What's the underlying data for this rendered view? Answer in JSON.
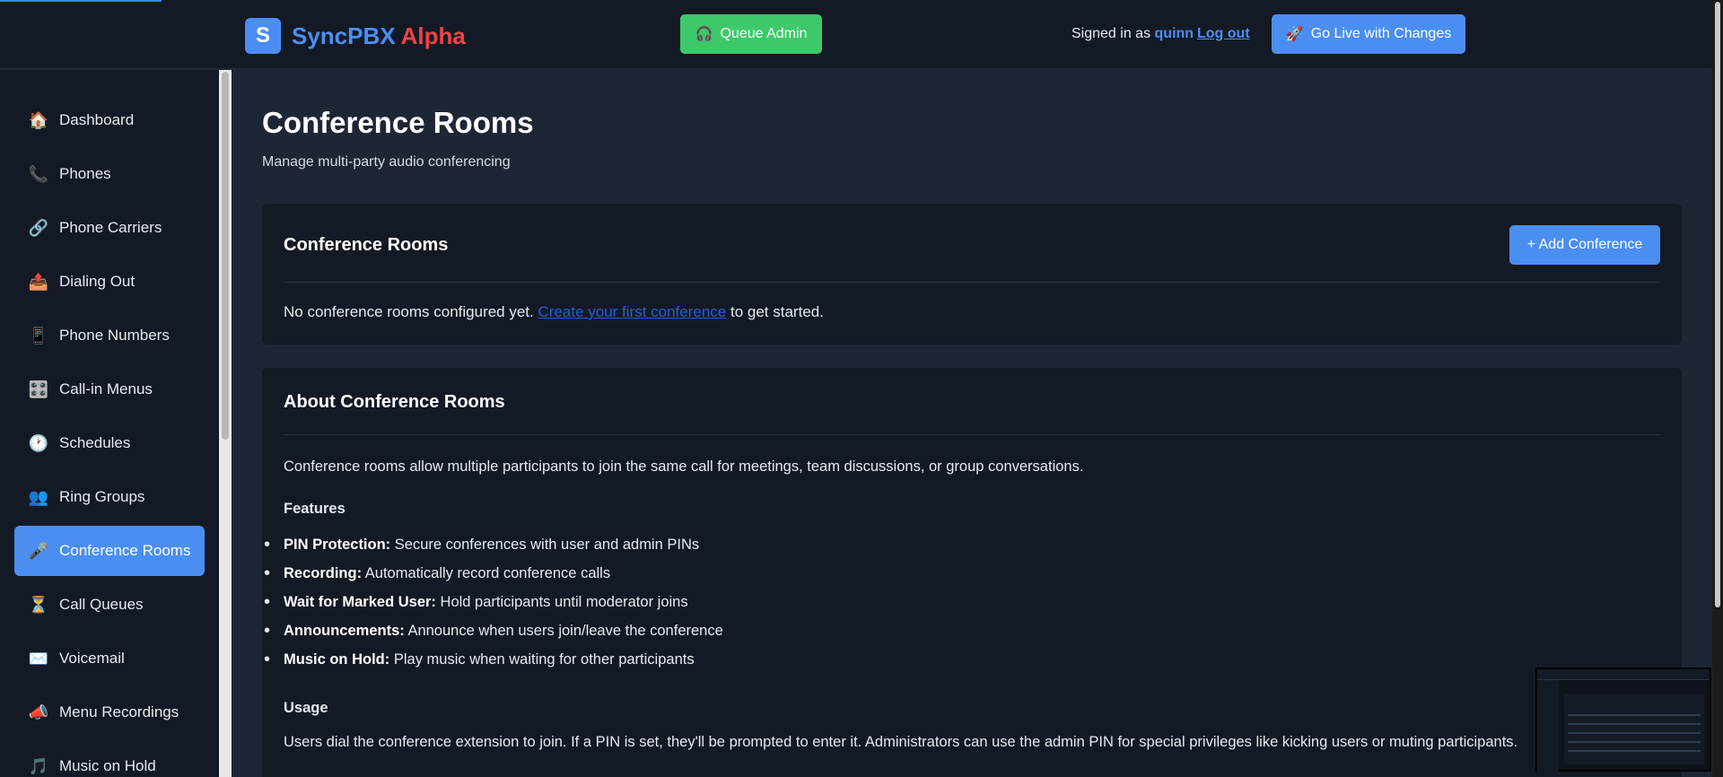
{
  "header": {
    "logo_letter": "S",
    "brand": "SyncPBX",
    "brand_suffix": "Alpha",
    "queue_admin_icon": "🎧",
    "queue_admin_label": "Queue Admin",
    "signed_in_prefix": "Signed in as",
    "username": "quinn",
    "logout_label": "Log out",
    "go_live_icon": "🚀",
    "go_live_label": "Go Live with Changes"
  },
  "sidebar": {
    "items": [
      {
        "icon": "🏠",
        "label": "Dashboard"
      },
      {
        "icon": "📞",
        "label": "Phones"
      },
      {
        "icon": "🔗",
        "label": "Phone Carriers"
      },
      {
        "icon": "📤",
        "label": "Dialing Out"
      },
      {
        "icon": "📱",
        "label": "Phone Numbers"
      },
      {
        "icon": "🎛️",
        "label": "Call-in Menus"
      },
      {
        "icon": "🕐",
        "label": "Schedules"
      },
      {
        "icon": "👥",
        "label": "Ring Groups"
      },
      {
        "icon": "🎤",
        "label": "Conference Rooms"
      },
      {
        "icon": "⏳",
        "label": "Call Queues"
      },
      {
        "icon": "✉️",
        "label": "Voicemail"
      },
      {
        "icon": "📣",
        "label": "Menu Recordings"
      },
      {
        "icon": "🎵",
        "label": "Music on Hold"
      }
    ],
    "active_index": 8
  },
  "page": {
    "title": "Conference Rooms",
    "subtitle": "Manage multi-party audio conferencing"
  },
  "rooms_card": {
    "title": "Conference Rooms",
    "add_label": "+ Add Conference",
    "empty_prefix": "No conference rooms configured yet.",
    "empty_link": "Create your first conference",
    "empty_suffix": "to get started."
  },
  "about_card": {
    "title": "About Conference Rooms",
    "intro": "Conference rooms allow multiple participants to join the same call for meetings, team discussions, or group conversations.",
    "features_heading": "Features",
    "features": [
      {
        "name": "PIN Protection:",
        "desc": "Secure conferences with user and admin PINs"
      },
      {
        "name": "Recording:",
        "desc": "Automatically record conference calls"
      },
      {
        "name": "Wait for Marked User:",
        "desc": "Hold participants until moderator joins"
      },
      {
        "name": "Announcements:",
        "desc": "Announce when users join/leave the conference"
      },
      {
        "name": "Music on Hold:",
        "desc": "Play music when waiting for other participants"
      }
    ],
    "usage_heading": "Usage",
    "usage_text": "Users dial the conference extension to join. If a PIN is set, they'll be prompted to enter it. Administrators can use the admin PIN for special privileges like kicking users or muting participants."
  },
  "colors": {
    "accent": "#4b8ef1",
    "brand_alpha": "#ef4444",
    "queue_admin": "#3dc96a",
    "background": "#1e2636",
    "panel": "#141a25"
  }
}
